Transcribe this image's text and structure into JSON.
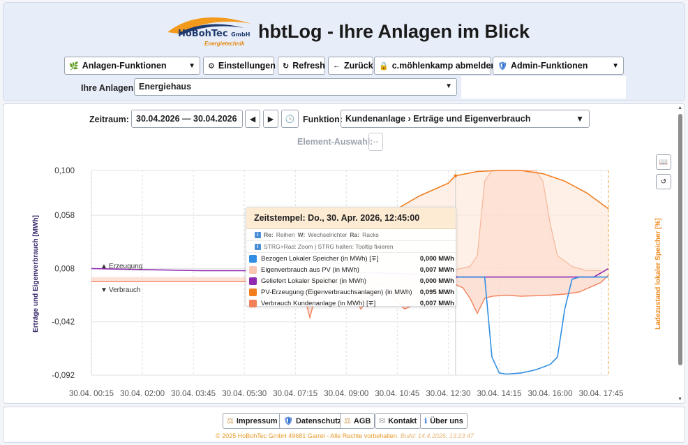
{
  "header": {
    "logo_text": "HoBohTec",
    "logo_gmbh": "GmbH",
    "logo_sub": "Energietechnik",
    "title": "hbtLog - Ihre Anlagen im Blick"
  },
  "toolbar": {
    "anlagen_funktionen": "Anlagen-Funktionen",
    "einstellungen": "Einstellungen",
    "refresh": "Refresh",
    "zurueck": "Zurück",
    "abmelden": "c.möhlenkamp abmelden",
    "admin_funktionen": "Admin-Funktionen"
  },
  "anlagen": {
    "label": "Ihre Anlagen:",
    "selected": "Energiehaus"
  },
  "controls": {
    "zeitraum_label": "Zeitraum:",
    "zeitraum_value": "30.04.2026 — 30.04.2026",
    "funktion_label": "Funktion:",
    "funktion_value": "Kundenanlage › Erträge und Eigenverbrauch",
    "element_label": "Element-Auswahl:",
    "element_value": "--"
  },
  "tooltip": {
    "title": "Zeitstempel: Do., 30. Apr. 2026, 12:45:00",
    "hint1_parts": [
      "Re:",
      "Reihen",
      "W:",
      "Wechselrichter",
      "Ra:",
      "Racks"
    ],
    "hint2": "STRG+Rad: Zoom | STRG halten: Tooltip fixieren",
    "rows": [
      {
        "color": "#2f8de4",
        "name": "Bezogen Lokaler Speicher (in MWh) [∓]",
        "value": "0,000 MWh"
      },
      {
        "color": "#f8c7b3",
        "name": "Eigenverbrauch aus PV (in MWh)",
        "value": "0,007 MWh"
      },
      {
        "color": "#8e2bb0",
        "name": "Geliefert Lokaler Speicher (in MWh)",
        "value": "0,000 MWh"
      },
      {
        "color": "#f07d1e",
        "name": "PV-Erzeugung (Eigenverbrauchsanlagen) (in MWh)",
        "value": "0,095 MWh"
      },
      {
        "color": "#f2805a",
        "name": "Verbrauch Kundenanlage (in MWh) [∓]",
        "value": "0,007 MWh"
      }
    ]
  },
  "chart_data": {
    "type": "line",
    "ylabel": "Erträge und Eigenverbrauch [MWh]",
    "y2label": "Ladezustand lokaler Speicher [%]",
    "yticks": [
      "0,100",
      "0,058",
      "0,008",
      "-0,042",
      "-0,092"
    ],
    "ylim": [
      -0.092,
      0.1
    ],
    "xticks": [
      "30.04. 00:15",
      "30.04. 02:00",
      "30.04. 03:45",
      "30.04. 05:30",
      "30.04. 07:15",
      "30.04. 09:00",
      "30.04. 10:45",
      "30.04. 12:30",
      "30.04. 14:15",
      "30.04. 16:00",
      "30.04. 17:45"
    ],
    "annotations": [
      "Erzeugung",
      "Verbrauch"
    ],
    "series": [
      {
        "name": "PV-Erzeugung (Eigenverbrauchsanlagen) (in MWh)",
        "color": "#f07d1e",
        "x": [
          9.0,
          10.5,
          11.5,
          12.5,
          12.75,
          13.5,
          14.25,
          15.0,
          15.75,
          16.5,
          17.25,
          18.0
        ],
        "y": [
          0.035,
          0.06,
          0.076,
          0.088,
          0.095,
          0.099,
          0.1,
          0.1,
          0.097,
          0.09,
          0.079,
          0.064
        ]
      },
      {
        "name": "Verbrauch Kundenanlage (in MWh) [∓]",
        "color": "#f2805a",
        "x": [
          0.25,
          1.5,
          3.0,
          4.5,
          6.0,
          7.0,
          7.5,
          7.75,
          8.0,
          8.5,
          9.0,
          9.5,
          10.0,
          10.25,
          10.5,
          11.0,
          11.5,
          11.75,
          12.0,
          12.5,
          12.75,
          13.0,
          13.25,
          13.5,
          13.75,
          14.0,
          14.5,
          15.0,
          16.0,
          16.5,
          17.0,
          17.75,
          18.0
        ],
        "y": [
          -0.004,
          -0.004,
          -0.004,
          -0.004,
          -0.004,
          -0.004,
          -0.012,
          -0.038,
          -0.012,
          -0.006,
          -0.008,
          -0.03,
          -0.01,
          -0.006,
          -0.016,
          -0.03,
          -0.024,
          -0.012,
          -0.02,
          -0.004,
          -0.007,
          -0.01,
          -0.02,
          -0.034,
          -0.02,
          -0.018,
          -0.017,
          -0.018,
          -0.017,
          -0.016,
          -0.014,
          -0.005,
          0.002
        ]
      },
      {
        "name": "Geliefert Lokaler Speicher (in MWh)",
        "color": "#8e2bb0",
        "x": [
          0.25,
          2.0,
          4.0,
          6.0,
          8.0,
          10.0,
          12.0,
          12.75,
          14.0,
          16.0,
          17.5,
          18.0
        ],
        "y": [
          0.008,
          0.007,
          0.006,
          0.006,
          0.005,
          0.004,
          0.002,
          0.0,
          0.0,
          0.0,
          0.0,
          0.008
        ]
      },
      {
        "name": "Bezogen Lokaler Speicher (in MWh) [∓]",
        "color": "#2f8de4",
        "x": [
          12.75,
          13.75,
          14.0,
          14.25,
          14.5,
          15.0,
          15.5,
          16.0,
          16.25,
          16.5,
          16.75,
          17.0,
          17.5,
          18.0
        ],
        "y": [
          0.0,
          0.0,
          -0.075,
          -0.09,
          -0.091,
          -0.09,
          -0.087,
          -0.082,
          -0.075,
          -0.03,
          -0.002,
          0.0,
          0.0,
          0.0
        ]
      },
      {
        "name": "Eigenverbrauch aus PV (in MWh)",
        "color": "#f8c7b3",
        "x": [
          12.75,
          13.25,
          13.5,
          13.75,
          14.0,
          15.5,
          15.75,
          16.0,
          16.25,
          16.75,
          17.25,
          17.75
        ],
        "y": [
          0.007,
          0.01,
          0.02,
          0.09,
          0.1,
          0.1,
          0.09,
          0.05,
          0.02,
          0.01,
          0.006,
          0.006
        ]
      }
    ]
  },
  "footer": {
    "impressum": "Impressum",
    "datenschutz": "Datenschutz",
    "agb": "AGB",
    "kontakt": "Kontakt",
    "ueber_uns": "Über uns",
    "copyright": "© 2025 HoBohTec GmbH 49681 Garrel - Alle Rechte vorbehalten.",
    "build": "Build: 14.4.2026, 13:23:47"
  }
}
